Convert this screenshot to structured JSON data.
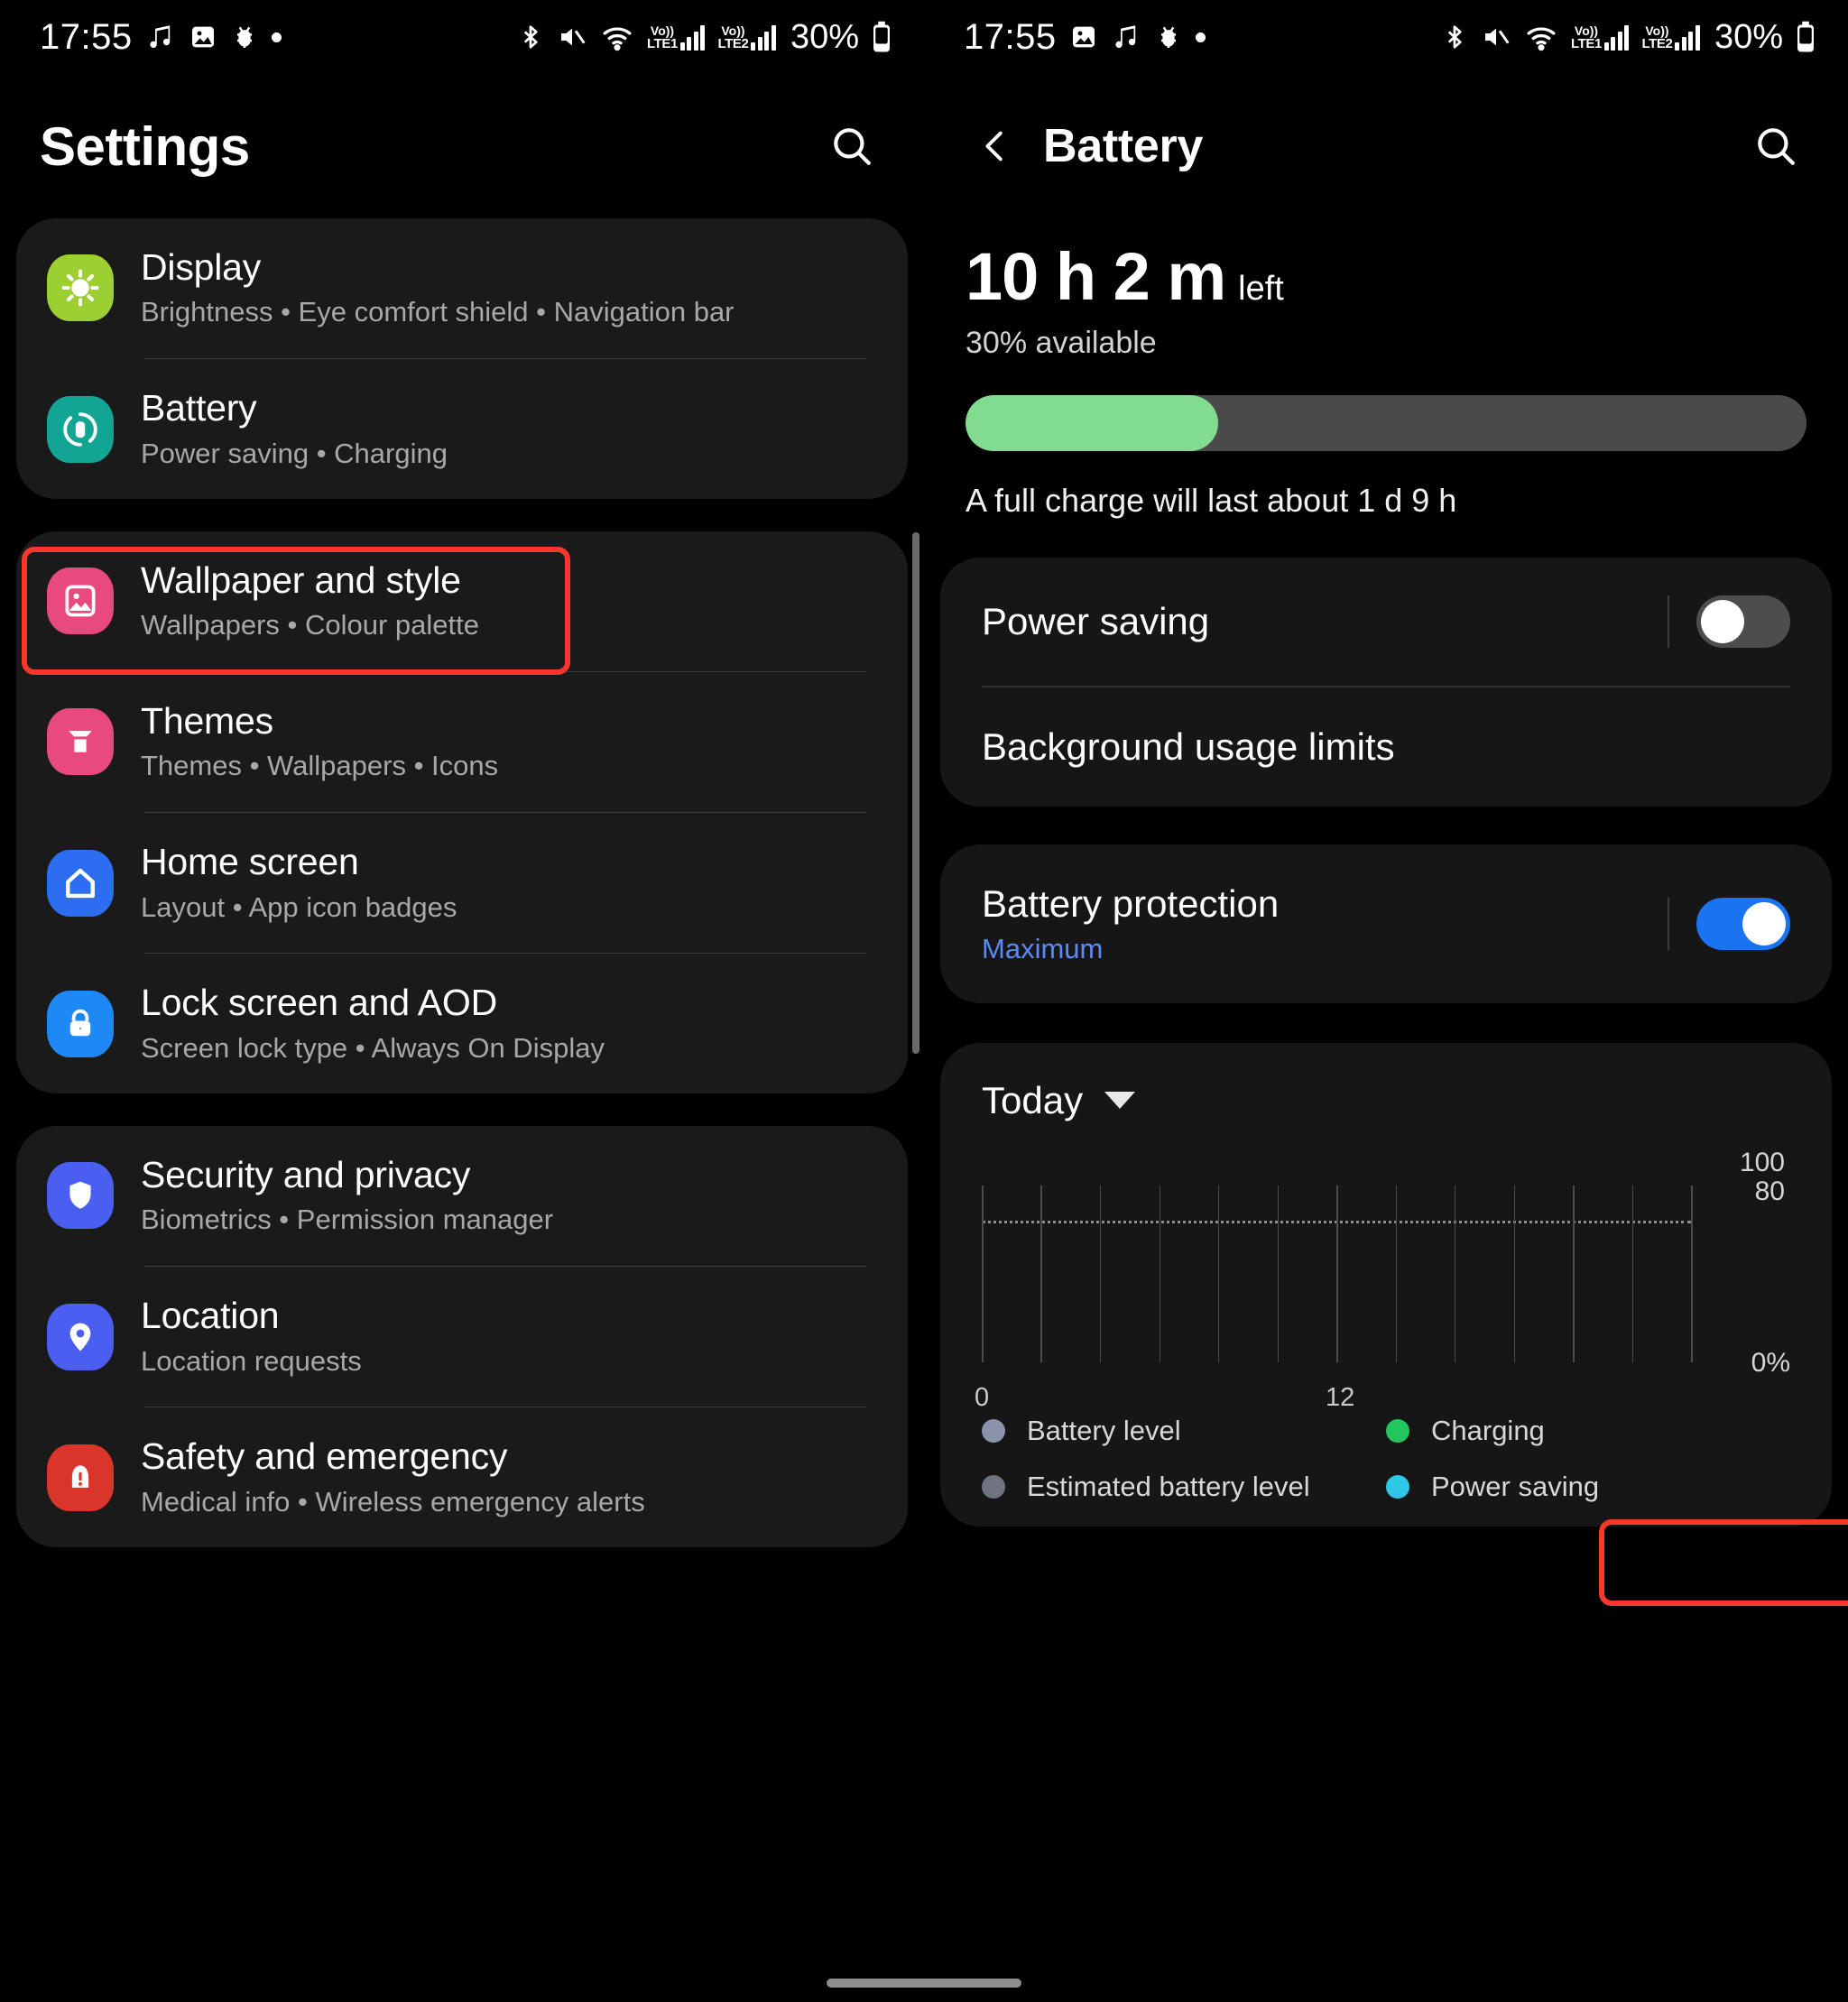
{
  "status_bar": {
    "time": "17:55",
    "battery_percent": "30%",
    "icons_left": [
      "music-note-icon",
      "image-icon",
      "alarm-bug-icon",
      "dot-icon"
    ],
    "icons_right": [
      "bluetooth-icon",
      "mute-icon",
      "wifi-icon",
      "volte-sim1-icon",
      "signal-sim1-icon",
      "volte-sim2-icon",
      "signal-sim2-icon",
      "battery-icon"
    ],
    "volte_1": {
      "t1": "Vo))",
      "t2": "LTE1"
    },
    "volte_2": {
      "t1": "Vo))",
      "t2": "LTE2"
    }
  },
  "settings_pane": {
    "title": "Settings",
    "search_icon": "search-icon",
    "groups": [
      {
        "items": [
          {
            "label": "Display",
            "sub": "Brightness  •  Eye comfort shield  •  Navigation bar",
            "icon": "sun-icon",
            "color": "#9ccf31"
          },
          {
            "label": "Battery",
            "sub": "Power saving  •  Charging",
            "icon": "battery-circle-icon",
            "color": "#12a594",
            "highlighted": true
          }
        ]
      },
      {
        "items": [
          {
            "label": "Wallpaper and style",
            "sub": "Wallpapers  •  Colour palette",
            "icon": "image-icon",
            "color": "#e84a7f"
          },
          {
            "label": "Themes",
            "sub": "Themes  •  Wallpapers  •  Icons",
            "icon": "theme-icon",
            "color": "#e84a7f"
          },
          {
            "label": "Home screen",
            "sub": "Layout  •  App icon badges",
            "icon": "home-icon",
            "color": "#2d6ef0"
          },
          {
            "label": "Lock screen and AOD",
            "sub": "Screen lock type  •  Always On Display",
            "icon": "lock-icon",
            "color": "#1e88f5"
          }
        ]
      },
      {
        "items": [
          {
            "label": "Security and privacy",
            "sub": "Biometrics  •  Permission manager",
            "icon": "shield-icon",
            "color": "#4a5ff0"
          },
          {
            "label": "Location",
            "sub": "Location requests",
            "icon": "location-pin-icon",
            "color": "#4a5ff0"
          },
          {
            "label": "Safety and emergency",
            "sub": "Medical info  •  Wireless emergency alerts",
            "icon": "emergency-icon",
            "color": "#d9352a"
          }
        ]
      }
    ]
  },
  "battery_pane": {
    "back_icon": "chevron-left-icon",
    "title": "Battery",
    "search_icon": "search-icon",
    "time_left": "10 h 2 m",
    "time_left_suffix": "left",
    "available": "30% available",
    "battery_level_pct": 30,
    "full_charge_note": "A full charge will last about 1 d 9 h",
    "bar_fill_color": "#81dc8f",
    "settings": [
      {
        "label": "Power saving",
        "toggle": "off"
      },
      {
        "label": "Background usage limits",
        "toggle": null,
        "highlighted": true
      }
    ],
    "protection": {
      "label": "Battery protection",
      "sub": "Maximum",
      "sub_color": "#5b8bf7",
      "toggle": "on"
    },
    "period_selector": {
      "label": "Today",
      "icon": "chevron-down-icon"
    }
  },
  "chart_data": {
    "type": "line",
    "title": "Today",
    "xlabel": "",
    "ylabel": "",
    "x_ticks": [
      "0",
      "12"
    ],
    "y_ticks": [
      "100",
      "80",
      "0%"
    ],
    "ylim": [
      0,
      100
    ],
    "xlim": [
      0,
      24
    ],
    "grid": true,
    "gridline_count": 13,
    "reference_line": {
      "value": 80,
      "style": "dotted"
    },
    "series": [
      {
        "name": "Battery level",
        "color": "#8a93ab",
        "values": []
      },
      {
        "name": "Charging",
        "color": "#22c55e",
        "values": []
      },
      {
        "name": "Estimated battery level",
        "color": "#6e7480",
        "values": []
      },
      {
        "name": "Power saving",
        "color": "#2ec7e8",
        "values": []
      }
    ],
    "legend": [
      {
        "label": "Battery level",
        "color": "#8a93ab"
      },
      {
        "label": "Charging",
        "color": "#22c55e"
      },
      {
        "label": "Estimated battery level",
        "color": "#6e7480"
      },
      {
        "label": "Power saving",
        "color": "#2ec7e8"
      }
    ],
    "legend_position": "bottom"
  }
}
